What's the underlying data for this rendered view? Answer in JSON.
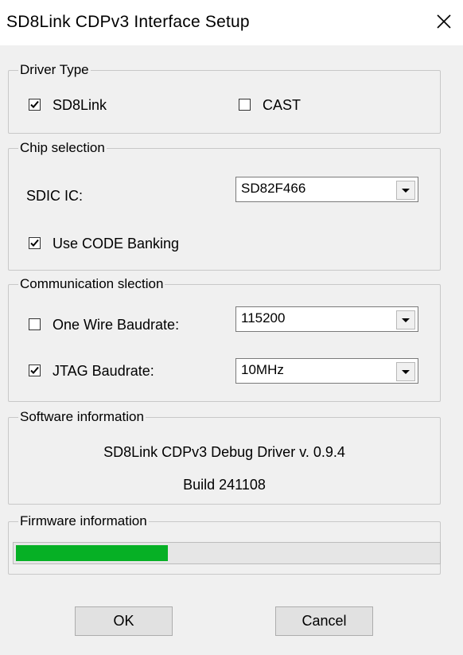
{
  "window": {
    "title": "SD8Link CDPv3 Interface Setup"
  },
  "driver_type": {
    "legend": "Driver Type",
    "sd8link": {
      "label": "SD8Link",
      "checked": true
    },
    "cast": {
      "label": "CAST",
      "checked": false
    }
  },
  "chip_selection": {
    "legend": "Chip selection",
    "sdic_label": "SDIC IC:",
    "sdic_value": "SD82F466",
    "code_banking": {
      "label": "Use CODE Banking",
      "checked": true
    }
  },
  "communication": {
    "legend": "Communication slection",
    "one_wire": {
      "label": "One Wire Baudrate:",
      "checked": false,
      "value": "115200"
    },
    "jtag": {
      "label": "JTAG Baudrate:",
      "checked": true,
      "value": "10MHz"
    }
  },
  "software": {
    "legend": "Software information",
    "driver_line": "SD8Link CDPv3 Debug Driver v. 0.9.4",
    "build_line": "Build 241108"
  },
  "firmware": {
    "legend": "Firmware information",
    "progress_fraction": 0.36,
    "progress_color": "#06b025"
  },
  "buttons": {
    "ok": "OK",
    "cancel": "Cancel"
  }
}
